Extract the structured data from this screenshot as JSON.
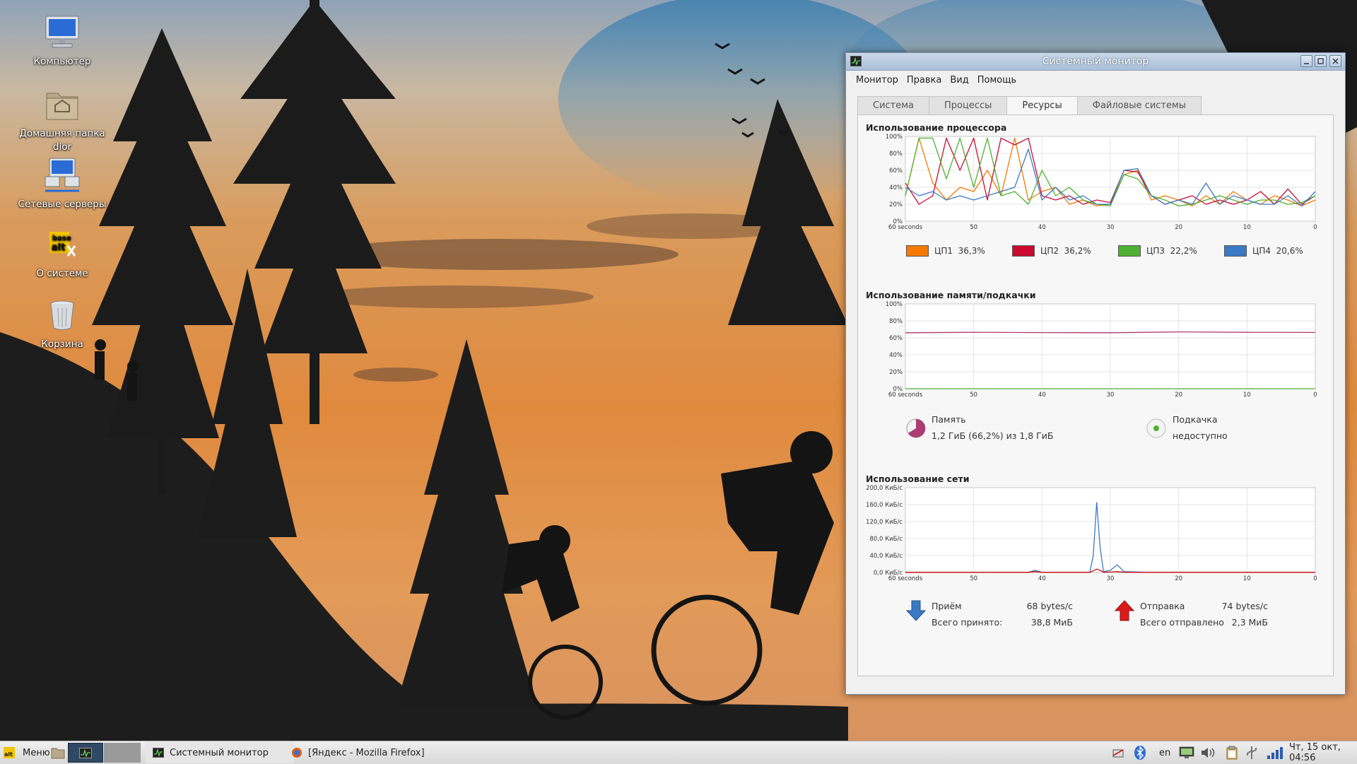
{
  "desktop": {
    "icons": [
      {
        "label": "Компьютер",
        "icon": "computer-icon"
      },
      {
        "label": "Домашняя папка dior",
        "icon": "home-folder-icon"
      },
      {
        "label": "Сетевые серверы",
        "icon": "network-servers-icon"
      },
      {
        "label": "О системе",
        "icon": "base-alt-logo-icon"
      },
      {
        "label": "Корзина",
        "icon": "trash-icon"
      }
    ]
  },
  "window": {
    "title": "Системный монитор",
    "menu": [
      "Монитор",
      "Правка",
      "Вид",
      "Помощь"
    ],
    "tabs": [
      {
        "label": "Система",
        "active": false
      },
      {
        "label": "Процессы",
        "active": false
      },
      {
        "label": "Ресурсы",
        "active": true
      },
      {
        "label": "Файловые системы",
        "active": false
      }
    ],
    "cpu": {
      "title": "Использование процессора",
      "y_ticks": [
        "100%",
        "80%",
        "60%",
        "40%",
        "20%",
        "0%"
      ],
      "x_ticks": [
        "60 seconds",
        "50",
        "40",
        "30",
        "20",
        "10",
        "0"
      ],
      "legend": [
        {
          "label": "ЦП1",
          "value": "36,3%",
          "color": "#f57900"
        },
        {
          "label": "ЦП2",
          "value": "36,2%",
          "color": "#cc0a30"
        },
        {
          "label": "ЦП3",
          "value": "22,2%",
          "color": "#4fb031"
        },
        {
          "label": "ЦП4",
          "value": "20,6%",
          "color": "#3a7ac4"
        }
      ]
    },
    "memory": {
      "title": "Использование памяти/подкачки",
      "y_ticks": [
        "100%",
        "80%",
        "60%",
        "40%",
        "20%",
        "0%"
      ],
      "x_ticks": [
        "60 seconds",
        "50",
        "40",
        "30",
        "20",
        "10",
        "0"
      ],
      "mem_label": "Память",
      "mem_value": "1,2 ГиБ (66,2%) из 1,8 ГиБ",
      "mem_color": "#ad3b74",
      "swap_label": "Подкачка",
      "swap_value": "недоступно",
      "swap_color": "#4fb031"
    },
    "network": {
      "title": "Использование сети",
      "y_ticks": [
        "200,0 КиБ/с",
        "160,0 КиБ/с",
        "120,0 КиБ/с",
        "80,0 КиБ/с",
        "40,0 КиБ/с",
        "0,0 КиБ/с"
      ],
      "x_ticks": [
        "60 seconds",
        "50",
        "40",
        "30",
        "20",
        "10",
        "0"
      ],
      "recv_label": "Приём",
      "recv_rate": "68 bytes/с",
      "recv_total_label": "Всего принято:",
      "recv_total": "38,8 МиБ",
      "recv_color": "#3a7ac4",
      "sent_label": "Отправка",
      "sent_rate": "74 bytes/с",
      "sent_total_label": "Всего отправлено",
      "sent_total": "2,3 МиБ",
      "sent_color": "#cc0a0a"
    }
  },
  "chart_data": [
    {
      "type": "line",
      "title": "Использование процессора",
      "x": [
        60,
        58,
        56,
        54,
        52,
        50,
        48,
        46,
        44,
        42,
        40,
        38,
        36,
        34,
        32,
        30,
        28,
        26,
        24,
        22,
        20,
        18,
        16,
        14,
        12,
        10,
        8,
        6,
        4,
        2,
        0
      ],
      "xlim": [
        60,
        0
      ],
      "ylim": [
        0,
        100
      ],
      "series": [
        {
          "name": "ЦП1",
          "values": [
            30,
            98,
            45,
            25,
            40,
            35,
            60,
            30,
            98,
            25,
            35,
            40,
            20,
            25,
            18,
            20,
            55,
            60,
            25,
            30,
            25,
            18,
            30,
            20,
            35,
            25,
            20,
            30,
            25,
            18,
            25
          ]
        },
        {
          "name": "ЦП2",
          "values": [
            45,
            20,
            30,
            98,
            60,
            98,
            25,
            98,
            90,
            98,
            30,
            25,
            30,
            20,
            25,
            22,
            60,
            58,
            30,
            20,
            25,
            30,
            20,
            25,
            20,
            25,
            35,
            20,
            38,
            20,
            30
          ]
        },
        {
          "name": "ЦП3",
          "values": [
            30,
            98,
            98,
            50,
            98,
            40,
            98,
            30,
            35,
            20,
            60,
            30,
            40,
            25,
            20,
            18,
            55,
            50,
            30,
            25,
            18,
            20,
            25,
            30,
            25,
            20,
            25,
            25,
            20,
            22,
            30
          ]
        },
        {
          "name": "ЦП4",
          "values": [
            40,
            30,
            35,
            25,
            30,
            25,
            30,
            35,
            40,
            85,
            25,
            40,
            25,
            30,
            20,
            20,
            60,
            62,
            30,
            20,
            25,
            20,
            45,
            20,
            30,
            25,
            20,
            20,
            30,
            18,
            35
          ]
        }
      ]
    },
    {
      "type": "line",
      "title": "Использование памяти/подкачки",
      "x": [
        60,
        50,
        40,
        30,
        20,
        10,
        0
      ],
      "xlim": [
        60,
        0
      ],
      "ylim": [
        0,
        100
      ],
      "series": [
        {
          "name": "Память",
          "values": [
            66,
            66.5,
            66.2,
            66,
            67,
            66.5,
            66.3
          ]
        },
        {
          "name": "Подкачка",
          "values": [
            0,
            0,
            0,
            0,
            0,
            0,
            0
          ]
        }
      ]
    },
    {
      "type": "line",
      "title": "Использование сети",
      "x": [
        60,
        50,
        42,
        41,
        40,
        33,
        32.5,
        32,
        31.5,
        31,
        30,
        29,
        28,
        25,
        20,
        10,
        0
      ],
      "xlim": [
        60,
        0
      ],
      "ylim": [
        0,
        200
      ],
      "series": [
        {
          "name": "Приём",
          "values": [
            0.5,
            0.5,
            0.5,
            5,
            0.5,
            0.5,
            40,
            165,
            60,
            2,
            5,
            18,
            2,
            0.5,
            0.5,
            0.5,
            0.5
          ]
        },
        {
          "name": "Отправка",
          "values": [
            0.3,
            0.3,
            0.3,
            2,
            0.3,
            0.3,
            4,
            8,
            5,
            0.5,
            1,
            2,
            0.5,
            0.3,
            0.3,
            0.3,
            0.3
          ]
        }
      ]
    }
  ],
  "taskbar": {
    "menu_label": "Меню",
    "tasks": [
      {
        "label": "Системный монитор",
        "icon": "system-monitor-icon"
      },
      {
        "label": "[Яндекс - Mozilla Firefox]",
        "icon": "firefox-icon"
      }
    ],
    "keyboard_layout": "en",
    "clock": "Чт, 15 окт, 04:56"
  }
}
